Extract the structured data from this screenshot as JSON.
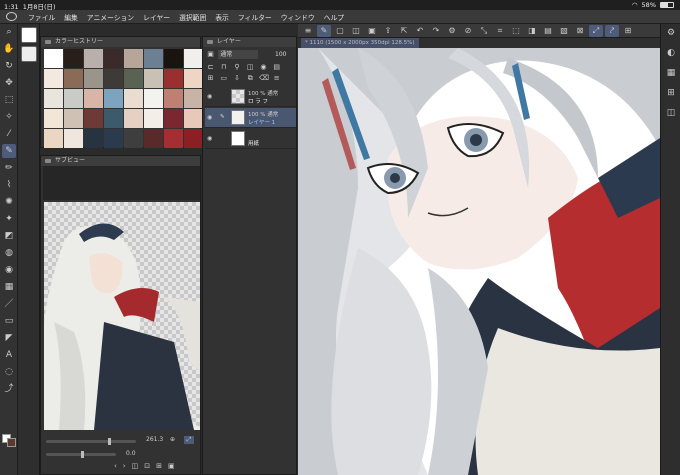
{
  "status_bar": {
    "time": "1:31",
    "date": "1月8日(日)",
    "battery": "58%"
  },
  "menu": [
    "ファイル",
    "編集",
    "アニメーション",
    "レイヤー",
    "選択範囲",
    "表示",
    "フィルター",
    "ウィンドウ",
    "ヘルプ"
  ],
  "color_history": {
    "title": "カラーヒストリー",
    "colors": [
      "#ffffff",
      "#2a1e1a",
      "#b9b0ab",
      "#3b2a2a",
      "#b7a59a",
      "#6d7f92",
      "#1a1410",
      "#f0efec",
      "#f4e9e0",
      "#8b6a57",
      "#9b948a",
      "#3e3a37",
      "#5a6353",
      "#c9c2b4",
      "#9b2e2e",
      "#efd5c6",
      "#e9e4dc",
      "#c9ccc6",
      "#d9b5a8",
      "#7da4bf",
      "#e8ddd0",
      "#f2f2ef",
      "#c07f73",
      "#c7b4a6",
      "#f1e6d8",
      "#cfc2b5",
      "#6e3a38",
      "#3d5a6a",
      "#e6d0c3",
      "#f3efe8",
      "#7b2630",
      "#e8c9b9",
      "#ead6c3",
      "#efe7df",
      "#273341",
      "#2c3a4e",
      "#3e3e3e",
      "#5a2a2a",
      "#a42e32",
      "#8a2024"
    ]
  },
  "sub_view": {
    "title": "サブビュー",
    "zoom": "261.3",
    "angle": "0.0"
  },
  "layers": {
    "title": "レイヤー",
    "blend_mode": "通常",
    "opacity": "100",
    "rows": [
      {
        "opacity_mode": "100 % 通常",
        "name": "ロ ラ フ",
        "selected": false
      },
      {
        "opacity_mode": "100 % 通常",
        "name": "レイヤー 1",
        "selected": true
      },
      {
        "opacity_mode": "",
        "name": "用紙",
        "selected": false
      }
    ]
  },
  "canvas_tab": "* 1110 (1500 x 2000px 350dpi 128.5%)",
  "colors": {
    "accent": "#4d5c7a",
    "panel": "#323232",
    "menubar": "#3a3a3a"
  }
}
